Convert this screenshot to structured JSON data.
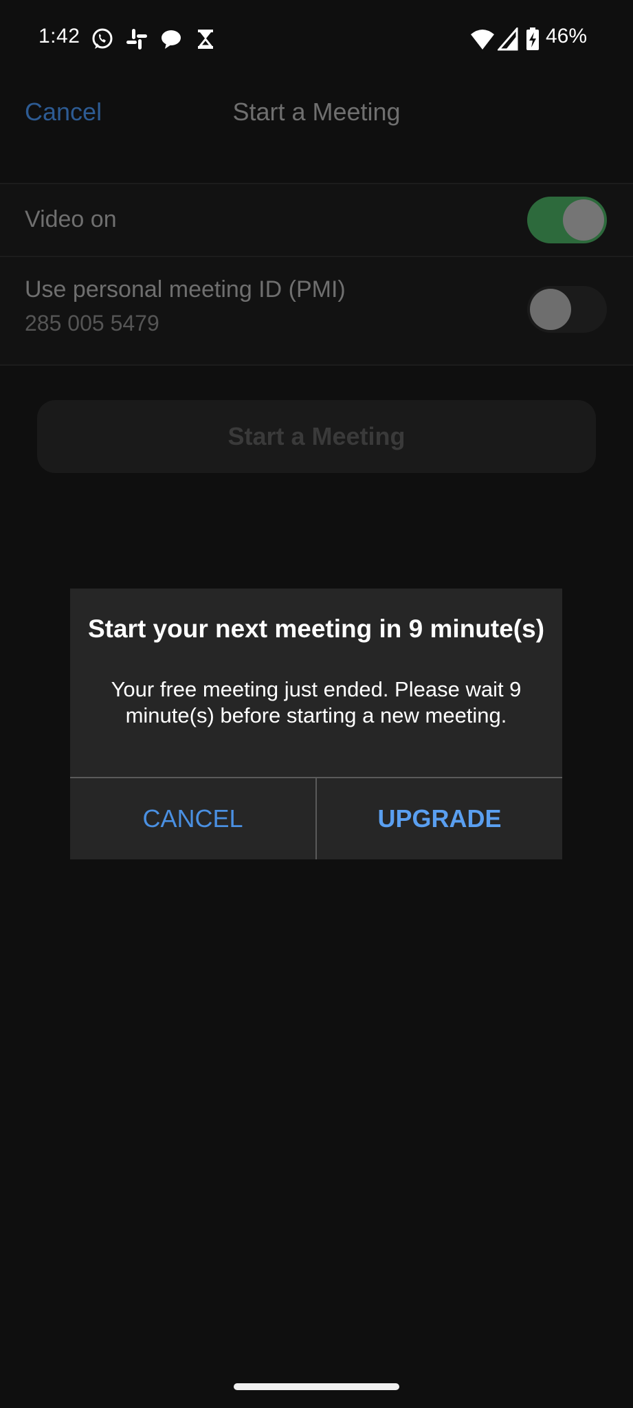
{
  "status_bar": {
    "time": "1:42",
    "battery_percent": "46%",
    "left_icons": [
      "whatsapp-icon",
      "slack-icon",
      "chat-bubble-icon",
      "hourglass-icon"
    ],
    "right_icons": [
      "wifi-icon",
      "signal-icon",
      "battery-charging-icon"
    ]
  },
  "header": {
    "cancel_label": "Cancel",
    "title": "Start a Meeting"
  },
  "settings": {
    "video": {
      "label": "Video on",
      "enabled": true
    },
    "pmi": {
      "label": "Use personal meeting ID (PMI)",
      "id": "285 005 5479",
      "enabled": false
    }
  },
  "start_button_label": "Start a Meeting",
  "dialog": {
    "title": "Start your next meeting in 9 minute(s)",
    "message": "Your free meeting just ended. Please wait 9 minute(s) before starting a new meeting.",
    "cancel_label": "CANCEL",
    "upgrade_label": "UPGRADE"
  },
  "colors": {
    "accent_blue": "#4a90e2",
    "toggle_on": "#2d6a3c",
    "background": "#0f0f0f",
    "dialog_background": "#262626"
  }
}
